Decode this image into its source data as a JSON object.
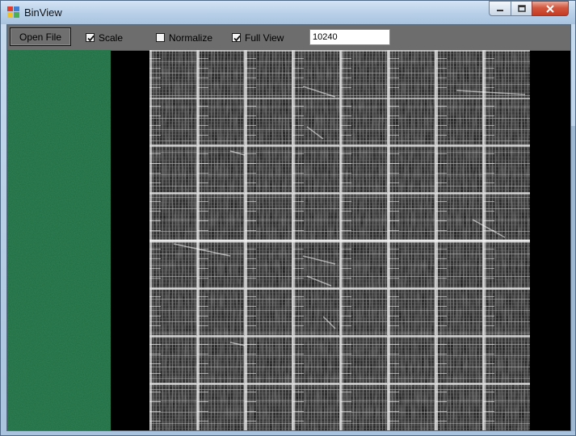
{
  "window": {
    "title": "BinView"
  },
  "toolbar": {
    "open_label": "Open File",
    "scale": {
      "label": "Scale",
      "checked": true
    },
    "normalize": {
      "label": "Normalize",
      "checked": false
    },
    "full_view": {
      "label": "Full View",
      "checked": true
    },
    "size_value": "10240"
  },
  "colors": {
    "green_panel": "#1e6b40",
    "toolbar_bg": "#6d6d6d",
    "view_bg": "#000000"
  },
  "icons": [
    "app-icon",
    "minimize-icon",
    "maximize-icon",
    "close-icon",
    "checkmark-icon"
  ]
}
